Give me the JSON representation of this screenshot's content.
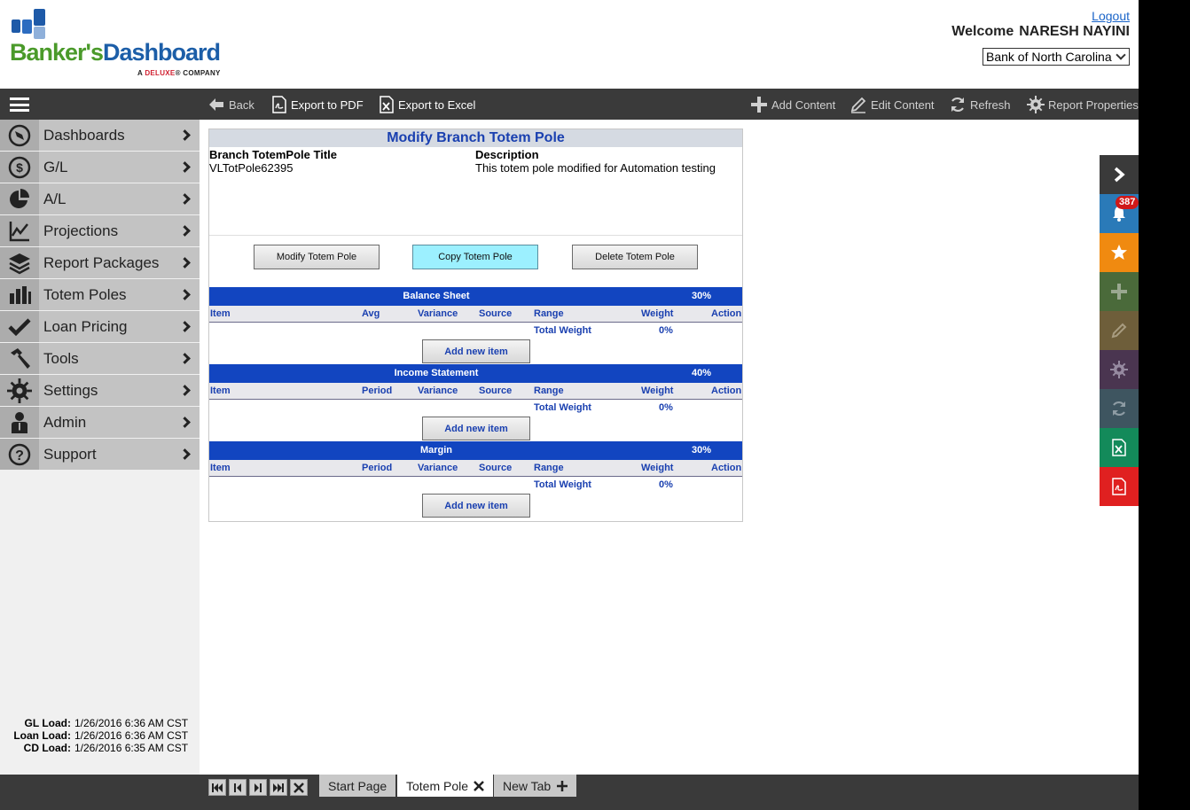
{
  "header": {
    "logo": {
      "brand_part1": "Banker's",
      "brand_part2": "Dashboard",
      "tagline_a": "A ",
      "tagline_b": "DELUXE",
      "tagline_c": "® COMPANY"
    },
    "logout_label": "Logout",
    "welcome_label": "Welcome",
    "user_name": "NARESH NAYINI",
    "bank_selected": "Bank of North Carolina"
  },
  "toolbar": {
    "back": "Back",
    "export_pdf": "Export to PDF",
    "export_excel": "Export to Excel",
    "add_content": "Add Content",
    "edit_content": "Edit Content",
    "refresh": "Refresh",
    "report_properties": "Report Properties"
  },
  "sidebar": {
    "items": [
      {
        "label": "Dashboards",
        "icon": "compass-icon"
      },
      {
        "label": "G/L",
        "icon": "dollar-icon"
      },
      {
        "label": "A/L",
        "icon": "pie-chart-icon"
      },
      {
        "label": "Projections",
        "icon": "line-chart-icon"
      },
      {
        "label": "Report Packages",
        "icon": "layers-icon"
      },
      {
        "label": "Totem Poles",
        "icon": "bar-chart-icon"
      },
      {
        "label": "Loan Pricing",
        "icon": "checkmark-icon"
      },
      {
        "label": "Tools",
        "icon": "hammer-icon"
      },
      {
        "label": "Settings",
        "icon": "gear-icon"
      },
      {
        "label": "Admin",
        "icon": "user-icon"
      },
      {
        "label": "Support",
        "icon": "question-icon"
      }
    ],
    "loads": [
      {
        "label": "GL Load:",
        "value": "1/26/2016 6:36 AM CST"
      },
      {
        "label": "Loan Load:",
        "value": "1/26/2016 6:36 AM CST"
      },
      {
        "label": "CD Load:",
        "value": "1/26/2016 6:35 AM CST"
      }
    ]
  },
  "panel": {
    "title": "Modify Branch Totem Pole",
    "title_label": "Branch TotemPole Title",
    "title_value": "VLTotPole62395",
    "description_label": "Description",
    "description_value": "This totem pole modified for Automation testing",
    "buttons": {
      "modify": "Modify Totem Pole",
      "copy": "Copy Totem Pole",
      "delete": "Delete Totem Pole"
    },
    "sections": [
      {
        "name": "Balance Sheet",
        "percent": "30%",
        "cols": [
          "Item",
          "Avg",
          "Variance",
          "Source",
          "Range",
          "Weight",
          "Action"
        ],
        "total_label": "Total Weight",
        "total_value": "0%",
        "add_label": "Add new item"
      },
      {
        "name": "Income Statement",
        "percent": "40%",
        "cols": [
          "Item",
          "Period",
          "Variance",
          "Source",
          "Range",
          "Weight",
          "Action"
        ],
        "total_label": "Total Weight",
        "total_value": "0%",
        "add_label": "Add new item"
      },
      {
        "name": "Margin",
        "percent": "30%",
        "cols": [
          "Item",
          "Period",
          "Variance",
          "Source",
          "Range",
          "Weight",
          "Action"
        ],
        "total_label": "Total Weight",
        "total_value": "0%",
        "add_label": "Add new item"
      }
    ]
  },
  "rail": {
    "notification_count": "387",
    "buttons": [
      {
        "icon": "chevron-right-icon",
        "color": "#3a3a3a"
      },
      {
        "icon": "bell-icon",
        "color": "#2a7ab8"
      },
      {
        "icon": "star-icon",
        "color": "#f08a10"
      },
      {
        "icon": "plus-icon",
        "color": "#4a6a3a"
      },
      {
        "icon": "pencil-icon",
        "color": "#6e5e3a"
      },
      {
        "icon": "gear-icon",
        "color": "#4a3550"
      },
      {
        "icon": "refresh-icon",
        "color": "#3e5560"
      },
      {
        "icon": "excel-icon",
        "color": "#138a5a"
      },
      {
        "icon": "pdf-icon",
        "color": "#e02020"
      }
    ]
  },
  "tabs": {
    "start_page": "Start Page",
    "totem_pole": "Totem Pole",
    "new_tab": "New Tab"
  }
}
